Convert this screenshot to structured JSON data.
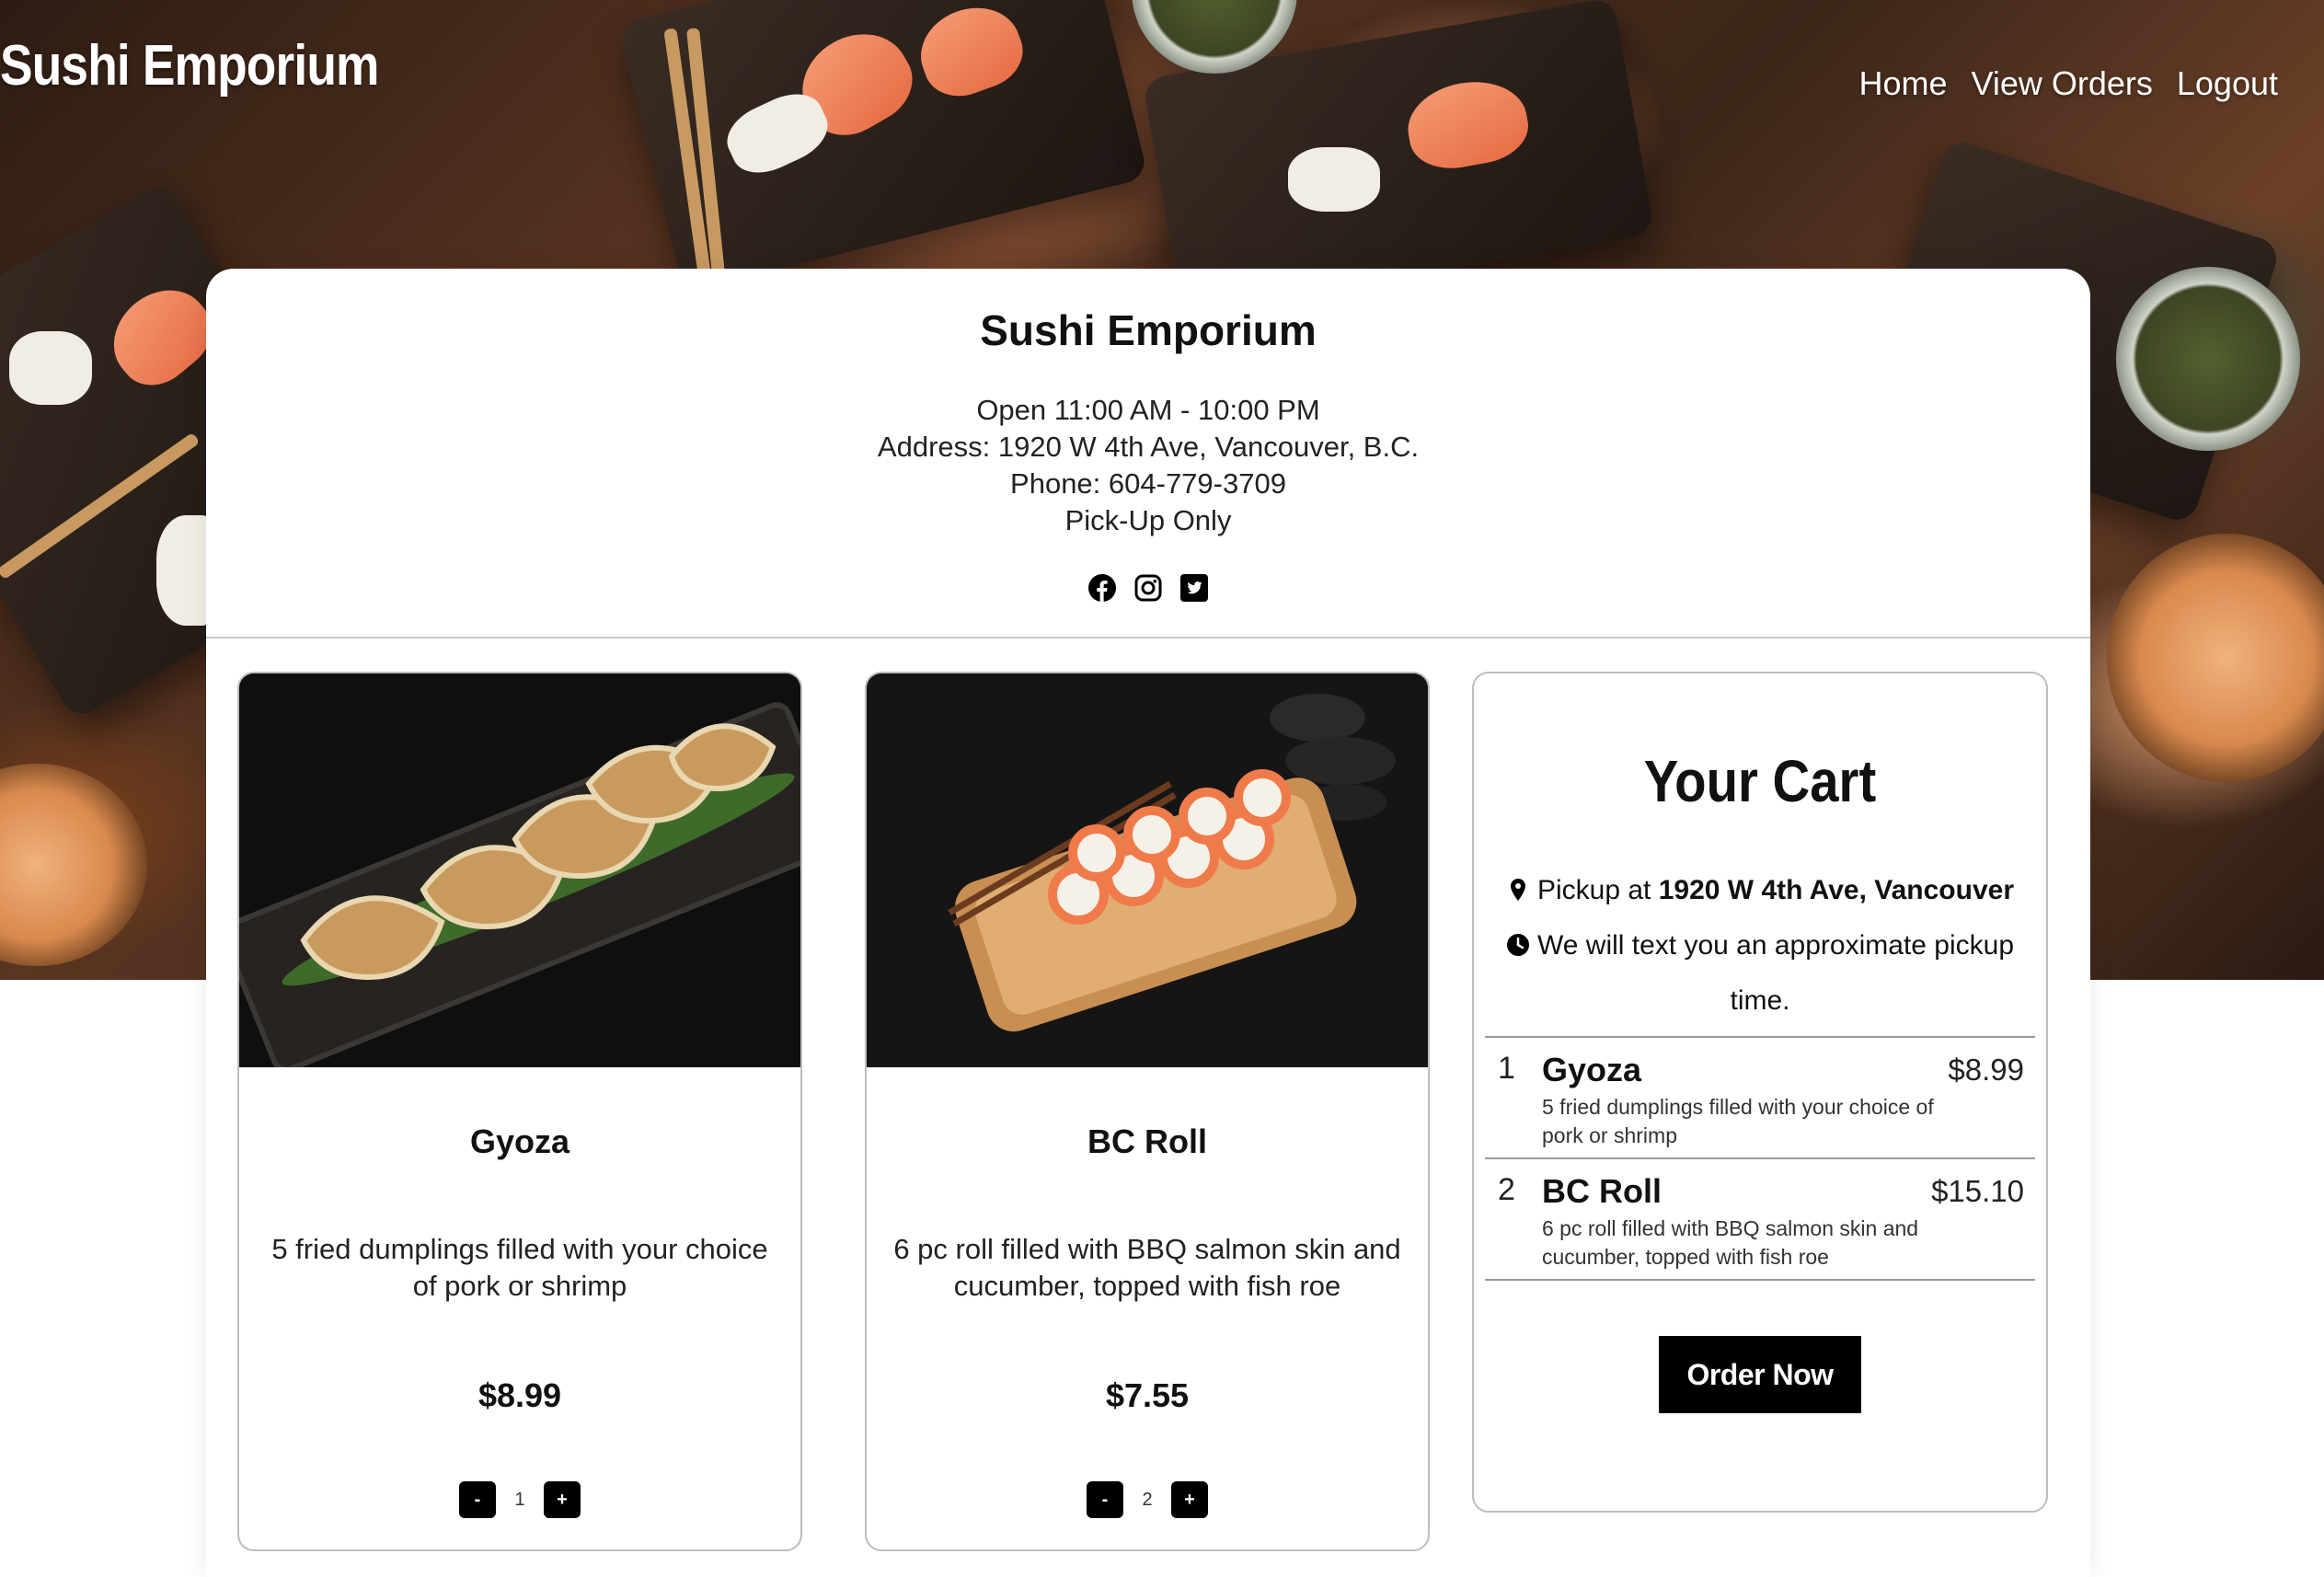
{
  "nav": {
    "brand": "Sushi Emporium",
    "links": [
      "Home",
      "View Orders",
      "Logout"
    ]
  },
  "restaurant": {
    "name": "Sushi Emporium",
    "hours": "Open 11:00 AM - 10:00 PM",
    "address": "Address: 1920 W 4th Ave, Vancouver, B.C.",
    "phone": "Phone: 604-779-3709",
    "pickup": "Pick-Up Only",
    "social_icons": [
      "facebook-icon",
      "instagram-icon",
      "twitter-icon"
    ]
  },
  "menu": [
    {
      "name": "Gyoza",
      "description": "5 fried dumplings filled with your choice of pork or shrimp",
      "price": "$8.99",
      "decrement": "-",
      "quantity": "1",
      "increment": "+"
    },
    {
      "name": "BC Roll",
      "description": "6 pc roll filled with BBQ salmon skin and cucumber, topped with fish roe",
      "price": "$7.55",
      "decrement": "-",
      "quantity": "2",
      "increment": "+"
    }
  ],
  "cart": {
    "title": "Your Cart",
    "pickup_prefix": "Pickup at ",
    "pickup_location": "1920 W 4th Ave, Vancouver",
    "notice": "We will text you an approximate pickup time.",
    "items": [
      {
        "qty": "1",
        "name": "Gyoza",
        "description": "5 fried dumplings filled with your choice of pork or shrimp",
        "price": "$8.99"
      },
      {
        "qty": "2",
        "name": "BC Roll",
        "description": "6 pc roll filled with BBQ salmon skin and cucumber, topped with fish roe",
        "price": "$15.10"
      }
    ],
    "order_button": "Order Now"
  },
  "colors": {
    "button": "#000000",
    "nav_text": "#ffffff",
    "border": "#bdbdbd"
  }
}
